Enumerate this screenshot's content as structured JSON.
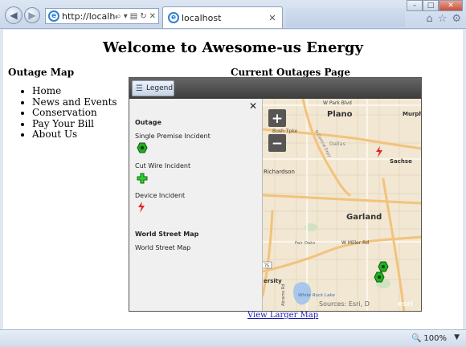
{
  "browser": {
    "address": "http://localhost",
    "tab_title": "localhost",
    "zoom_level": "100%"
  },
  "page": {
    "site_title": "Welcome to Awesome-us Energy",
    "sidebar_heading": "Outage Map",
    "nav_items": [
      "Home",
      "News and Events",
      "Conservation",
      "Pay Your Bill",
      "About Us"
    ],
    "content_heading": "Current Outages Page",
    "larger_map_link": "View Larger Map"
  },
  "map": {
    "legend_button": "Legend",
    "zoom_in": "+",
    "zoom_out": "−",
    "legend": {
      "outage_heading": "Outage",
      "items": [
        "Single Premise Incident",
        "Cut Wire Incident",
        "Device Incident"
      ],
      "basemap_heading": "World Street Map",
      "basemap_item": "World Street Map"
    },
    "places": {
      "plano": "Plano",
      "park_blvd": "W Park Blvd",
      "murphy": "Murph",
      "tollway": "Bush Tpke",
      "central": "N Central Expy",
      "dallas": "Dallas",
      "sachse": "Sachse",
      "richardson": "Richardson",
      "garland": "Garland",
      "miller": "W Miller Rd",
      "fair_oaks": "Fair Oaks",
      "route": "75",
      "abrams": "Abrams Rd",
      "university": "ersity",
      "white_rock": "White Rock Lake",
      "attribution": "Sources: Esri, D",
      "logo": "esri"
    },
    "colors": {
      "land": "#f1e7d2",
      "highway": "#f3c27c",
      "premise_marker": "#1fb21f",
      "wire_marker": "#33cc33",
      "device_marker": "#e52121"
    }
  }
}
